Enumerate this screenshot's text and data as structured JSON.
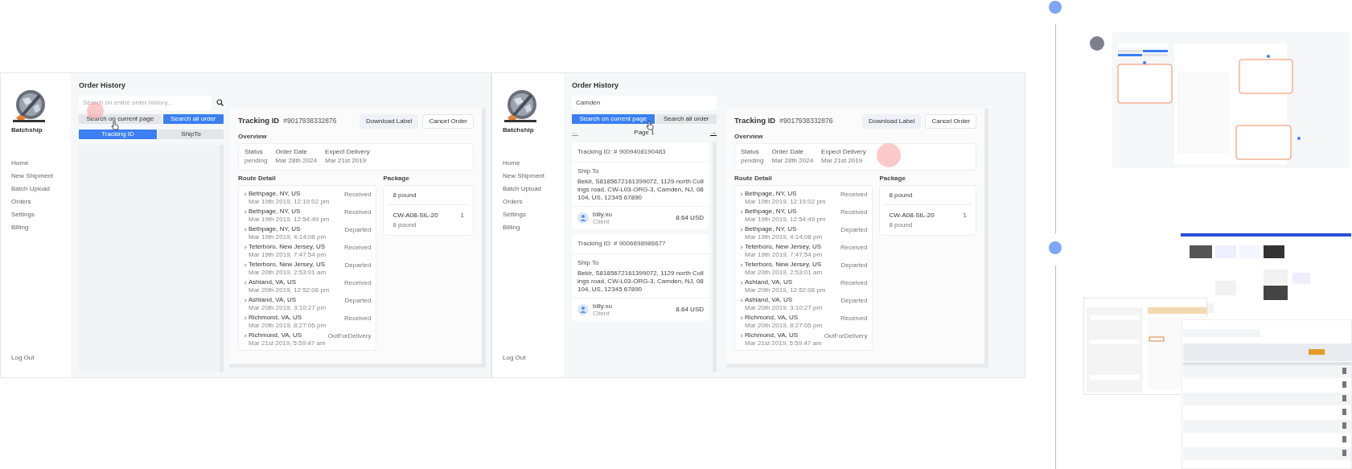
{
  "screens": [
    {
      "sidebar": {
        "brand": "Batchship",
        "items": [
          "Home",
          "New Shipment",
          "Batch Upload",
          "Orders",
          "Settings",
          "Billing"
        ],
        "logout": "Log Out"
      },
      "title": "Order History",
      "search": {
        "placeholder": "Search on entire order history..."
      },
      "search_scope": [
        {
          "label": "Search on current page",
          "selected": false
        },
        {
          "label": "Search all order",
          "selected": true
        }
      ],
      "search_by": [
        {
          "label": "Tracking ID",
          "selected": true
        },
        {
          "label": "ShipTo",
          "selected": false
        }
      ],
      "detail": {
        "tracking_label": "Tracking ID",
        "tracking_id": "#9017938332876",
        "actions": [
          {
            "label": "Download Label",
            "kind": "secondary"
          },
          {
            "label": "Cancel Order",
            "kind": "tertiary"
          }
        ],
        "overview_title": "Overview",
        "overview": [
          {
            "label": "Status",
            "value": "pending"
          },
          {
            "label": "Order Date",
            "value": "Mar 28th 2024"
          },
          {
            "label": "Expect Delivery",
            "value": "Mar 21st 2019"
          }
        ],
        "route_title": "Route Detail",
        "route": [
          {
            "place": "Bethpage, NY, US",
            "time": "Mar 19th 2019, 12:19:02 pm",
            "status": "Received"
          },
          {
            "place": "Bethpage, NY, US",
            "time": "Mar 19th 2019, 12:54:49 pm",
            "status": "Received"
          },
          {
            "place": "Bethpage, NY, US",
            "time": "Mar 19th 2019, 4:14:08 pm",
            "status": "Departed"
          },
          {
            "place": "Teterboro, New Jersey, US",
            "time": "Mar 19th 2019, 7:47:54 pm",
            "status": "Received"
          },
          {
            "place": "Teterboro, New Jersey, US",
            "time": "Mar 20th 2019, 2:53:01 am",
            "status": "Departed"
          },
          {
            "place": "Ashland, VA, US",
            "time": "Mar 20th 2019, 12:52:06 pm",
            "status": "Received"
          },
          {
            "place": "Ashland, VA, US",
            "time": "Mar 20th 2019, 3:10:27 pm",
            "status": "Departed"
          },
          {
            "place": "Richmond, VA, US",
            "time": "Mar 20th 2019, 8:27:05 pm",
            "status": "Received"
          },
          {
            "place": "Richmond, VA, US",
            "time": "Mar 21st 2019, 5:59:47 am",
            "status": "OutForDelivery"
          }
        ],
        "package_title": "Package",
        "package": {
          "weight": "8 pound",
          "items": [
            {
              "sku": "CW-A08-SIL-20",
              "weight": "8 pound",
              "qty": "1"
            }
          ]
        }
      }
    },
    {
      "sidebar": {
        "brand": "Batchship",
        "items": [
          "Home",
          "New Shipment",
          "Batch Upload",
          "Orders",
          "Settings",
          "Billing"
        ],
        "logout": "Log Out"
      },
      "title": "Order History",
      "search": {
        "value": "Camden"
      },
      "search_scope": [
        {
          "label": "Search on current page",
          "selected": true
        },
        {
          "label": "Search all order",
          "selected": false
        }
      ],
      "pager": {
        "prev": "←",
        "label": "Page 1",
        "next": "→"
      },
      "orders": [
        {
          "tracking_label": "Tracking ID:",
          "tracking_id": "# 9009408190483",
          "ship_to_label": "Ship To",
          "address": "Bekir, S8185672161399072, 1129 north Collings road, CW-L03-ORG-3, Camden, NJ, 08104, US, 12345 67890",
          "user": "billy.xu",
          "role": "Client",
          "amount": "8.64 USD"
        },
        {
          "tracking_label": "Tracking ID:",
          "tracking_id": "# 9006698986677",
          "ship_to_label": "Ship To",
          "address": "Bekir, S8185672161399072, 1129 north Collings road, CW-L03-ORG-3, Camden, NJ, 08104, US, 12345 67890",
          "user": "billy.xu",
          "role": "Client",
          "amount": "8.64 USD"
        }
      ],
      "detail": {
        "tracking_label": "Tracking ID",
        "tracking_id": "#9017938332876",
        "actions": [
          {
            "label": "Download Label",
            "kind": "secondary"
          },
          {
            "label": "Cancel Order",
            "kind": "tertiary"
          }
        ],
        "overview_title": "Overview",
        "overview": [
          {
            "label": "Status",
            "value": "pending"
          },
          {
            "label": "Order Date",
            "value": "Mar 28th 2024"
          },
          {
            "label": "Expect Delivery",
            "value": "Mar 21st 2019"
          }
        ],
        "route_title": "Route Detail",
        "route": [
          {
            "place": "Bethpage, NY, US",
            "time": "Mar 19th 2019, 12:19:02 pm",
            "status": "Received"
          },
          {
            "place": "Bethpage, NY, US",
            "time": "Mar 19th 2019, 12:54:49 pm",
            "status": "Received"
          },
          {
            "place": "Bethpage, NY, US",
            "time": "Mar 19th 2019, 4:14:08 pm",
            "status": "Departed"
          },
          {
            "place": "Teterboro, New Jersey, US",
            "time": "Mar 19th 2019, 7:47:54 pm",
            "status": "Received"
          },
          {
            "place": "Teterboro, New Jersey, US",
            "time": "Mar 20th 2019, 2:53:01 am",
            "status": "Departed"
          },
          {
            "place": "Ashland, VA, US",
            "time": "Mar 20th 2019, 12:52:06 pm",
            "status": "Received"
          },
          {
            "place": "Ashland, VA, US",
            "time": "Mar 20th 2019, 3:10:27 pm",
            "status": "Departed"
          },
          {
            "place": "Richmond, VA, US",
            "time": "Mar 20th 2019, 8:27:05 pm",
            "status": "Received"
          },
          {
            "place": "Richmond, VA, US",
            "time": "Mar 21st 2019, 5:59:47 am",
            "status": "OutForDelivery"
          }
        ],
        "package_title": "Package",
        "package": {
          "weight": "8 pound",
          "items": [
            {
              "sku": "CW-A08-SIL-20",
              "weight": "8 pound",
              "qty": "1"
            }
          ]
        }
      }
    }
  ]
}
